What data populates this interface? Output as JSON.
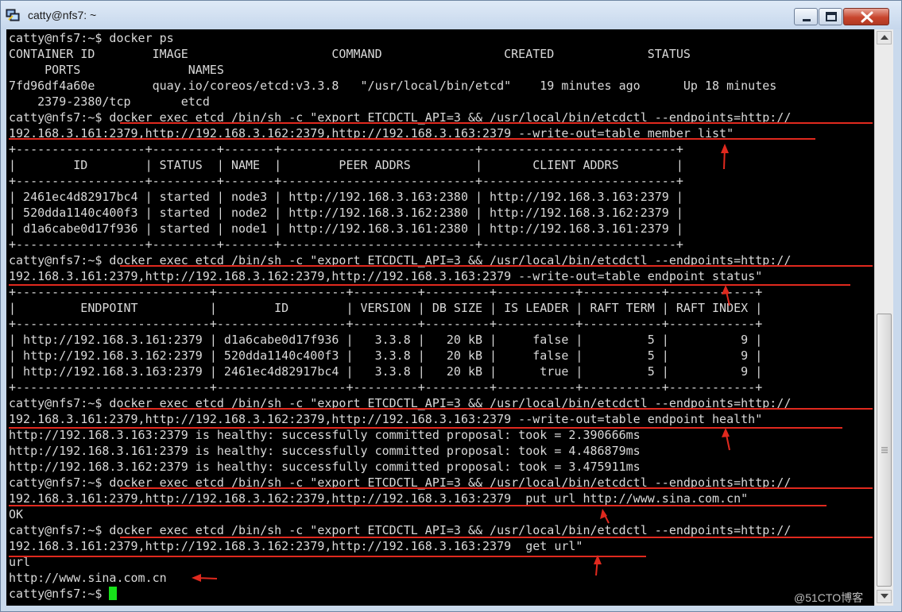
{
  "window": {
    "title": "catty@nfs7: ~",
    "icon": "putty-icon",
    "buttons": [
      "minimize-icon",
      "maximize-icon",
      "close-icon"
    ]
  },
  "terminal": {
    "foreground": "#d9d9d9",
    "background": "#000000",
    "cursor_color": "#17e21a",
    "annotation_color": "#e0291e",
    "lines": [
      "catty@nfs7:~$ docker ps",
      "CONTAINER ID        IMAGE                    COMMAND                 CREATED             STATUS",
      "     PORTS               NAMES",
      "7fd96df4a60e        quay.io/coreos/etcd:v3.3.8   \"/usr/local/bin/etcd\"    19 minutes ago      Up 18 minutes",
      "    2379-2380/tcp       etcd",
      "catty@nfs7:~$ docker exec etcd /bin/sh -c \"export ETCDCTL_API=3 && /usr/local/bin/etcdctl --endpoints=http://",
      "192.168.3.161:2379,http://192.168.3.162:2379,http://192.168.3.163:2379 --write-out=table member list\"",
      "+------------------+---------+-------+---------------------------+---------------------------+",
      "|        ID        | STATUS  | NAME  |        PEER ADDRS         |       CLIENT ADDRS        |",
      "+------------------+---------+-------+---------------------------+---------------------------+",
      "| 2461ec4d82917bc4 | started | node3 | http://192.168.3.163:2380 | http://192.168.3.163:2379 |",
      "| 520dda1140c400f3 | started | node2 | http://192.168.3.162:2380 | http://192.168.3.162:2379 |",
      "| d1a6cabe0d17f936 | started | node1 | http://192.168.3.161:2380 | http://192.168.3.161:2379 |",
      "+------------------+---------+-------+---------------------------+---------------------------+",
      "catty@nfs7:~$ docker exec etcd /bin/sh -c \"export ETCDCTL_API=3 && /usr/local/bin/etcdctl --endpoints=http://",
      "192.168.3.161:2379,http://192.168.3.162:2379,http://192.168.3.163:2379 --write-out=table endpoint status\"",
      "+---------------------------+------------------+---------+---------+-----------+-----------+------------+",
      "|         ENDPOINT          |        ID        | VERSION | DB SIZE | IS LEADER | RAFT TERM | RAFT INDEX |",
      "+---------------------------+------------------+---------+---------+-----------+-----------+------------+",
      "| http://192.168.3.161:2379 | d1a6cabe0d17f936 |   3.3.8 |   20 kB |     false |         5 |          9 |",
      "| http://192.168.3.162:2379 | 520dda1140c400f3 |   3.3.8 |   20 kB |     false |         5 |          9 |",
      "| http://192.168.3.163:2379 | 2461ec4d82917bc4 |   3.3.8 |   20 kB |      true |         5 |          9 |",
      "+---------------------------+------------------+---------+---------+-----------+-----------+------------+",
      "catty@nfs7:~$ docker exec etcd /bin/sh -c \"export ETCDCTL_API=3 && /usr/local/bin/etcdctl --endpoints=http://",
      "192.168.3.161:2379,http://192.168.3.162:2379,http://192.168.3.163:2379 --write-out=table endpoint health\"",
      "http://192.168.3.163:2379 is healthy: successfully committed proposal: took = 2.390666ms",
      "http://192.168.3.161:2379 is healthy: successfully committed proposal: took = 4.486879ms",
      "http://192.168.3.162:2379 is healthy: successfully committed proposal: took = 3.475911ms",
      "catty@nfs7:~$ docker exec etcd /bin/sh -c \"export ETCDCTL_API=3 && /usr/local/bin/etcdctl --endpoints=http://",
      "192.168.3.161:2379,http://192.168.3.162:2379,http://192.168.3.163:2379  put url http://www.sina.com.cn\"",
      "OK",
      "catty@nfs7:~$ docker exec etcd /bin/sh -c \"export ETCDCTL_API=3 && /usr/local/bin/etcdctl --endpoints=http://",
      "192.168.3.161:2379,http://192.168.3.162:2379,http://192.168.3.163:2379  get url\"",
      "url",
      "http://www.sina.com.cn",
      "catty@nfs7:~$ "
    ]
  },
  "watermark": "@51CTO博客"
}
